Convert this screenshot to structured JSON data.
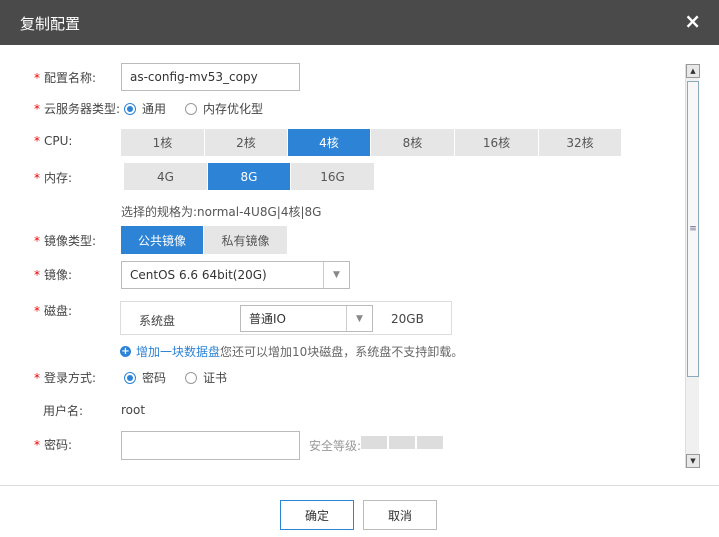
{
  "dialog": {
    "title": "复制配置",
    "close_icon": "×"
  },
  "form": {
    "config_name": {
      "label": "配置名称:",
      "value": "as-config-mv53_copy"
    },
    "server_type": {
      "label": "云服务器类型:",
      "options": [
        "通用",
        "内存优化型"
      ],
      "selected": "通用"
    },
    "cpu": {
      "label": "CPU:",
      "options": [
        "1核",
        "2核",
        "4核",
        "8核",
        "16核",
        "32核"
      ],
      "selected": "4核"
    },
    "memory": {
      "label": "内存:",
      "options": [
        "4G",
        "8G",
        "16G"
      ],
      "selected": "8G"
    },
    "spec_hint": "选择的规格为:normal-4U8G|4核|8G",
    "image_type": {
      "label": "镜像类型:",
      "options": [
        "公共镜像",
        "私有镜像"
      ],
      "selected": "公共镜像"
    },
    "image": {
      "label": "镜像:",
      "value": "CentOS 6.6 64bit(20G)"
    },
    "disk": {
      "label": "磁盘:",
      "system_disk_label": "系统盘",
      "disk_type": "普通IO",
      "size": "20GB",
      "add_link": "增加一块数据盘",
      "add_hint": "您还可以增加10块磁盘，系统盘不支持卸载。"
    },
    "login": {
      "label": "登录方式:",
      "options": [
        "密码",
        "证书"
      ],
      "selected": "密码"
    },
    "username": {
      "label": "用户名:",
      "value": "root"
    },
    "password": {
      "label": "密码:",
      "value": "",
      "strength_label": "安全等级:"
    }
  },
  "footer": {
    "confirm": "确定",
    "cancel": "取消"
  },
  "colors": {
    "accent": "#2d83d6",
    "titlebar": "#4a4a4a",
    "required": "#e00000"
  }
}
